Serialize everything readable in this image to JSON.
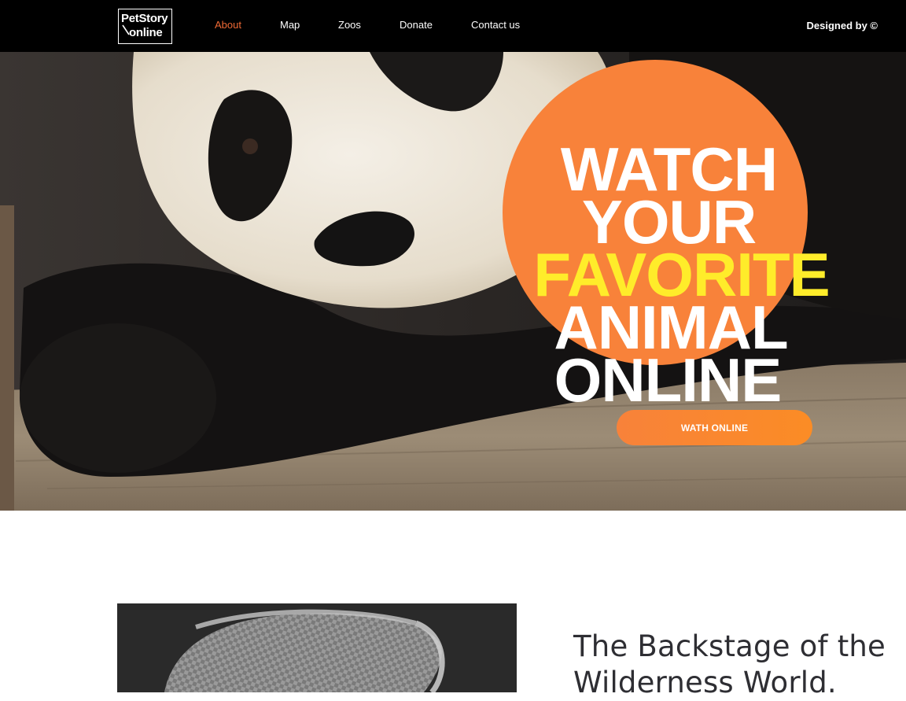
{
  "header": {
    "logo": {
      "line1": "PetStory",
      "line2": "online"
    },
    "nav": [
      {
        "label": "About",
        "active": true
      },
      {
        "label": "Map",
        "active": false
      },
      {
        "label": "Zoos",
        "active": false
      },
      {
        "label": "Donate",
        "active": false
      },
      {
        "label": "Contact us",
        "active": false
      }
    ],
    "designed_by": "Designed by ©"
  },
  "hero": {
    "headline": [
      "WATCH",
      "YOUR",
      "FAVORITE",
      "ANIMAL",
      "ONLINE"
    ],
    "highlight_word": "FAVORITE",
    "cta_label": "WATH ONLINE",
    "image_subject": "panda-photo"
  },
  "about": {
    "title_line1": "The Backstage of the",
    "title_line2": "Wilderness World.",
    "image_subject": "woven-basket-photo"
  },
  "colors": {
    "header_bg": "#000000",
    "nav_active": "#f06a35",
    "accent_orange": "#f8823a",
    "highlight_yellow": "#ffec2a",
    "text_dark": "#2e2e33"
  }
}
